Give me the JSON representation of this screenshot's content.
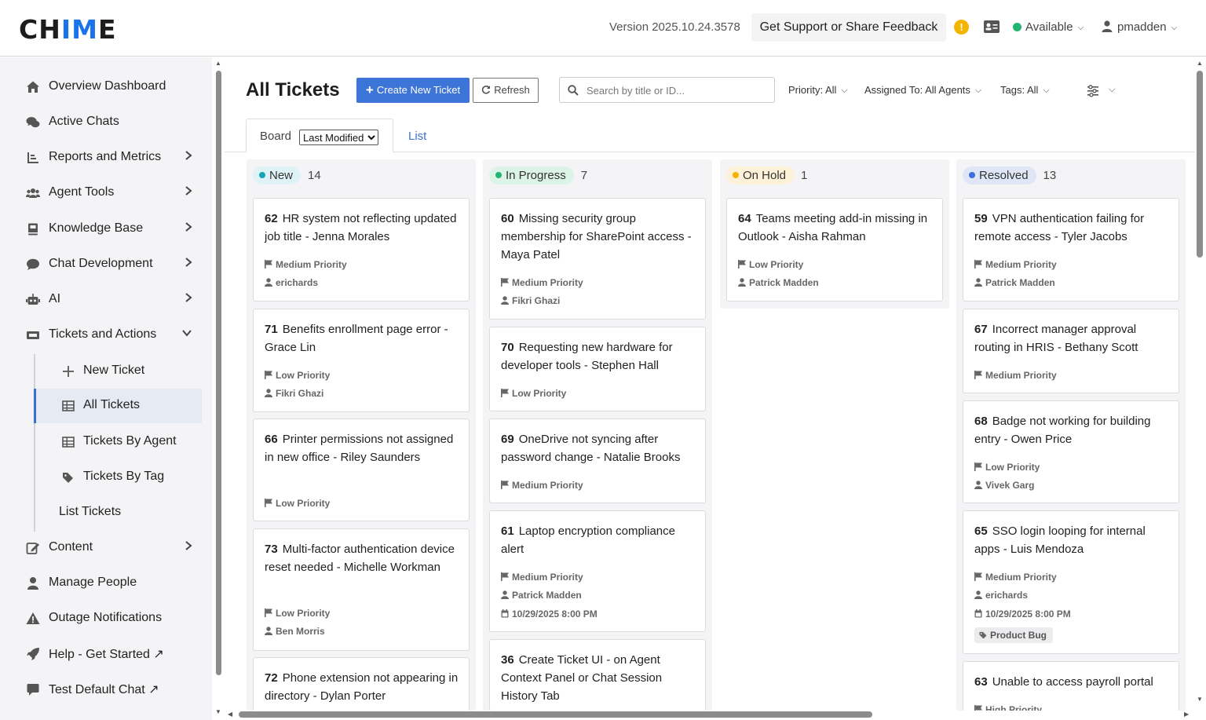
{
  "header": {
    "logo_left": "CH",
    "logo_mid": "IM",
    "logo_right": "E",
    "version": "Version 2025.10.24.3578",
    "support_button": "Get Support or Share Feedback",
    "warning_glyph": "!",
    "status": "Available",
    "username": "pmadden"
  },
  "sidebar": {
    "items": [
      {
        "label": "Overview Dashboard",
        "icon": "home-icon"
      },
      {
        "label": "Active Chats",
        "icon": "chats-icon"
      },
      {
        "label": "Reports and Metrics",
        "icon": "reports-icon"
      },
      {
        "label": "Agent Tools",
        "icon": "users-icon"
      },
      {
        "label": "Knowledge Base",
        "icon": "book-icon"
      },
      {
        "label": "Chat Development",
        "icon": "chat-bubble-icon"
      },
      {
        "label": "AI",
        "icon": "robot-icon"
      },
      {
        "label": "Tickets and Actions",
        "icon": "ticket-icon"
      },
      {
        "label": "Content",
        "icon": "edit-icon"
      },
      {
        "label": "Manage People",
        "icon": "person-icon"
      },
      {
        "label": "Outage Notifications",
        "icon": "warning-icon"
      },
      {
        "label": "Help - Get Started ↗",
        "icon": "rocket-icon"
      },
      {
        "label": "Test Default Chat ↗",
        "icon": "message-icon"
      }
    ],
    "sub_items": [
      {
        "label": "New Ticket",
        "icon": "plus-icon"
      },
      {
        "label": "All Tickets",
        "icon": "table-icon"
      },
      {
        "label": "Tickets By Agent",
        "icon": "table-icon"
      },
      {
        "label": "Tickets By Tag",
        "icon": "tags-icon"
      },
      {
        "label": "List Tickets",
        "icon": ""
      }
    ]
  },
  "main": {
    "title": "All Tickets",
    "create_button": "Create New Ticket",
    "refresh_button": "Refresh",
    "search_placeholder": "Search by title or ID...",
    "filters": {
      "priority": "Priority: All",
      "assigned": "Assigned To: All Agents",
      "tags": "Tags: All"
    },
    "tabs": {
      "board": "Board",
      "sort_selected": "Last Modified",
      "list": "List"
    }
  },
  "columns": [
    {
      "name": "New",
      "count": "14",
      "color": "#17a2b8",
      "bg": "#dff3f6",
      "cards": [
        {
          "id": "62",
          "title": "HR system not reflecting updated job title - Jenna Morales",
          "priority": "Medium Priority",
          "agent": "erichards"
        },
        {
          "id": "71",
          "title": "Benefits enrollment page error - Grace Lin",
          "priority": "Low Priority",
          "agent": "Fikri Ghazi"
        },
        {
          "id": "66",
          "title": "Printer permissions not assigned in new office - Riley Saunders",
          "priority": "Low Priority"
        },
        {
          "id": "73",
          "title": "Multi-factor authentication device reset needed - Michelle Workman",
          "priority": "Low Priority",
          "agent": "Ben Morris"
        },
        {
          "id": "72",
          "title": "Phone extension not appearing in directory - Dylan Porter"
        }
      ]
    },
    {
      "name": "In Progress",
      "count": "7",
      "color": "#22b573",
      "bg": "#dcf3e8",
      "cards": [
        {
          "id": "60",
          "title": "Missing security group membership for SharePoint access - Maya Patel",
          "priority": "Medium Priority",
          "agent": "Fikri Ghazi"
        },
        {
          "id": "70",
          "title": "Requesting new hardware for developer tools - Stephen Hall",
          "priority": "Low Priority"
        },
        {
          "id": "69",
          "title": "OneDrive not syncing after password change - Natalie Brooks",
          "priority": "Medium Priority"
        },
        {
          "id": "61",
          "title": "Laptop encryption compliance alert",
          "priority": "Medium Priority",
          "agent": "Patrick Madden",
          "due": "10/29/2025 8:00 PM"
        },
        {
          "id": "36",
          "title": "Create Ticket UI - on Agent Context Panel or Chat Session History Tab"
        }
      ]
    },
    {
      "name": "On Hold",
      "count": "1",
      "color": "#f4b400",
      "bg": "#fdf1d8",
      "cards": [
        {
          "id": "64",
          "title": "Teams meeting add-in missing in Outlook - Aisha Rahman",
          "priority": "Low Priority",
          "agent": "Patrick Madden"
        }
      ]
    },
    {
      "name": "Resolved",
      "count": "13",
      "color": "#3b6ed8",
      "bg": "#dfe7f7",
      "cards": [
        {
          "id": "59",
          "title": "VPN authentication failing for remote access - Tyler Jacobs",
          "priority": "Medium Priority",
          "agent": "Patrick Madden"
        },
        {
          "id": "67",
          "title": "Incorrect manager approval routing in HRIS - Bethany Scott",
          "priority": "Medium Priority"
        },
        {
          "id": "68",
          "title": "Badge not working for building entry - Owen Price",
          "priority": "Low Priority",
          "agent": "Vivek Garg"
        },
        {
          "id": "65",
          "title": "SSO login looping for internal apps - Luis Mendoza",
          "priority": "Medium Priority",
          "agent": "erichards",
          "due": "10/29/2025 8:00 PM",
          "tag": "Product Bug"
        },
        {
          "id": "63",
          "title": "Unable to access payroll portal",
          "priority": "High Priority"
        }
      ]
    }
  ]
}
